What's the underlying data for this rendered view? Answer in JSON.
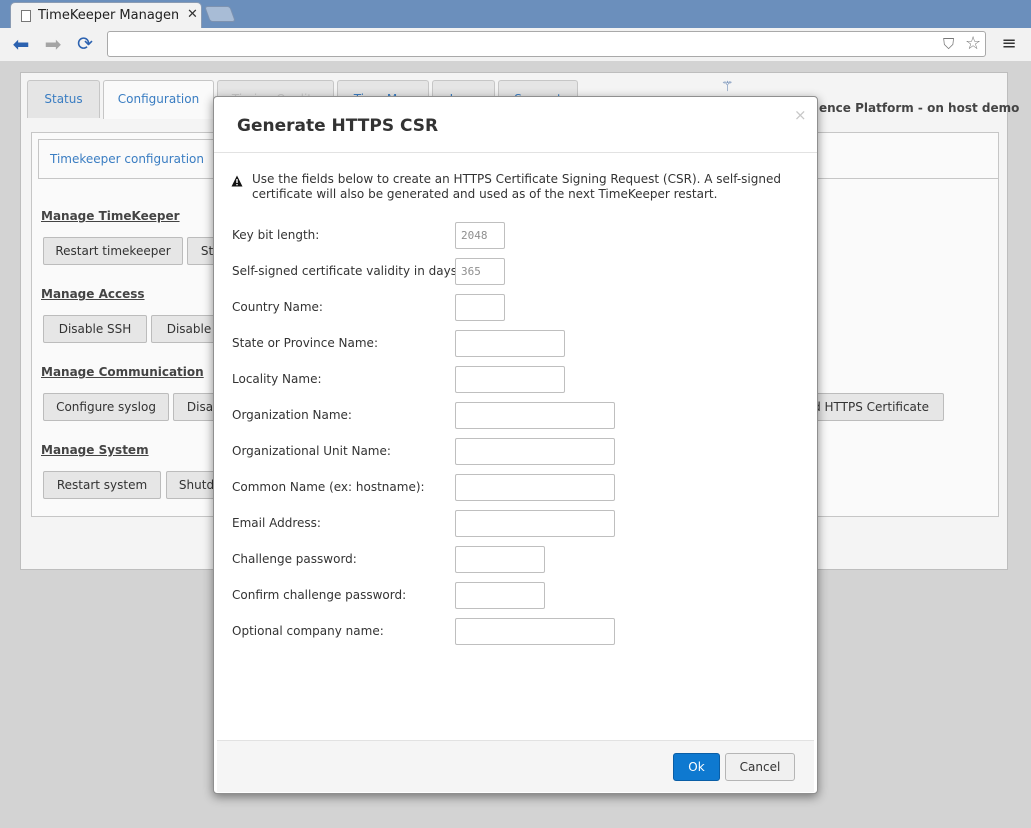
{
  "browser": {
    "tab_title": "TimeKeeper Management",
    "url": ""
  },
  "app": {
    "tabs": [
      {
        "label": "Status"
      },
      {
        "label": "Configuration"
      },
      {
        "label": "Timing Quality"
      },
      {
        "label": "Time Map"
      },
      {
        "label": "Logs"
      },
      {
        "label": "Support"
      }
    ],
    "platform_text": "ence Platform - on host demo",
    "subtab": "Timekeeper configuration",
    "sections": {
      "timekeeper": {
        "heading": "Manage TimeKeeper",
        "buttons": [
          "Restart timekeeper",
          "St"
        ]
      },
      "access": {
        "heading": "Manage Access",
        "buttons": [
          "Disable SSH",
          "Disable"
        ]
      },
      "communication": {
        "heading": "Manage Communication",
        "buttons": [
          "Configure syslog",
          "Disa",
          "d HTTPS Certificate"
        ]
      },
      "system": {
        "heading": "Manage System",
        "buttons": [
          "Restart system",
          "Shutd"
        ]
      }
    }
  },
  "modal": {
    "title": "Generate HTTPS CSR",
    "close": "×",
    "note": "Use the fields below to create an HTTPS Certificate Signing Request (CSR). A self-signed certificate will also be generated and used as of the next TimeKeeper restart.",
    "fields": [
      {
        "label": "Key bit length:",
        "value": "2048"
      },
      {
        "label": "Self-signed certificate validity in days:",
        "value": "365"
      },
      {
        "label": "Country Name:",
        "value": ""
      },
      {
        "label": "State or Province Name:",
        "value": ""
      },
      {
        "label": "Locality Name:",
        "value": ""
      },
      {
        "label": "Organization Name:",
        "value": ""
      },
      {
        "label": "Organizational Unit Name:",
        "value": ""
      },
      {
        "label": "Common Name (ex: hostname):",
        "value": ""
      },
      {
        "label": "Email Address:",
        "value": ""
      },
      {
        "label": "Challenge password:",
        "value": ""
      },
      {
        "label": "Confirm challenge password:",
        "value": ""
      },
      {
        "label": "Optional company name:",
        "value": ""
      }
    ],
    "ok_label": "Ok",
    "cancel_label": "Cancel"
  },
  "colors": {
    "tabstrip": "#6b8fbc",
    "link_blue": "#3a7dc2",
    "ok_blue": "#0e79d0"
  },
  "icons": [
    "document-icon",
    "tab-close-icon",
    "back-arrow-icon",
    "forward-arrow-icon",
    "reload-icon",
    "shield-icon",
    "star-icon",
    "menu-icon",
    "logo-icon",
    "warning-icon",
    "modal-close-icon"
  ]
}
